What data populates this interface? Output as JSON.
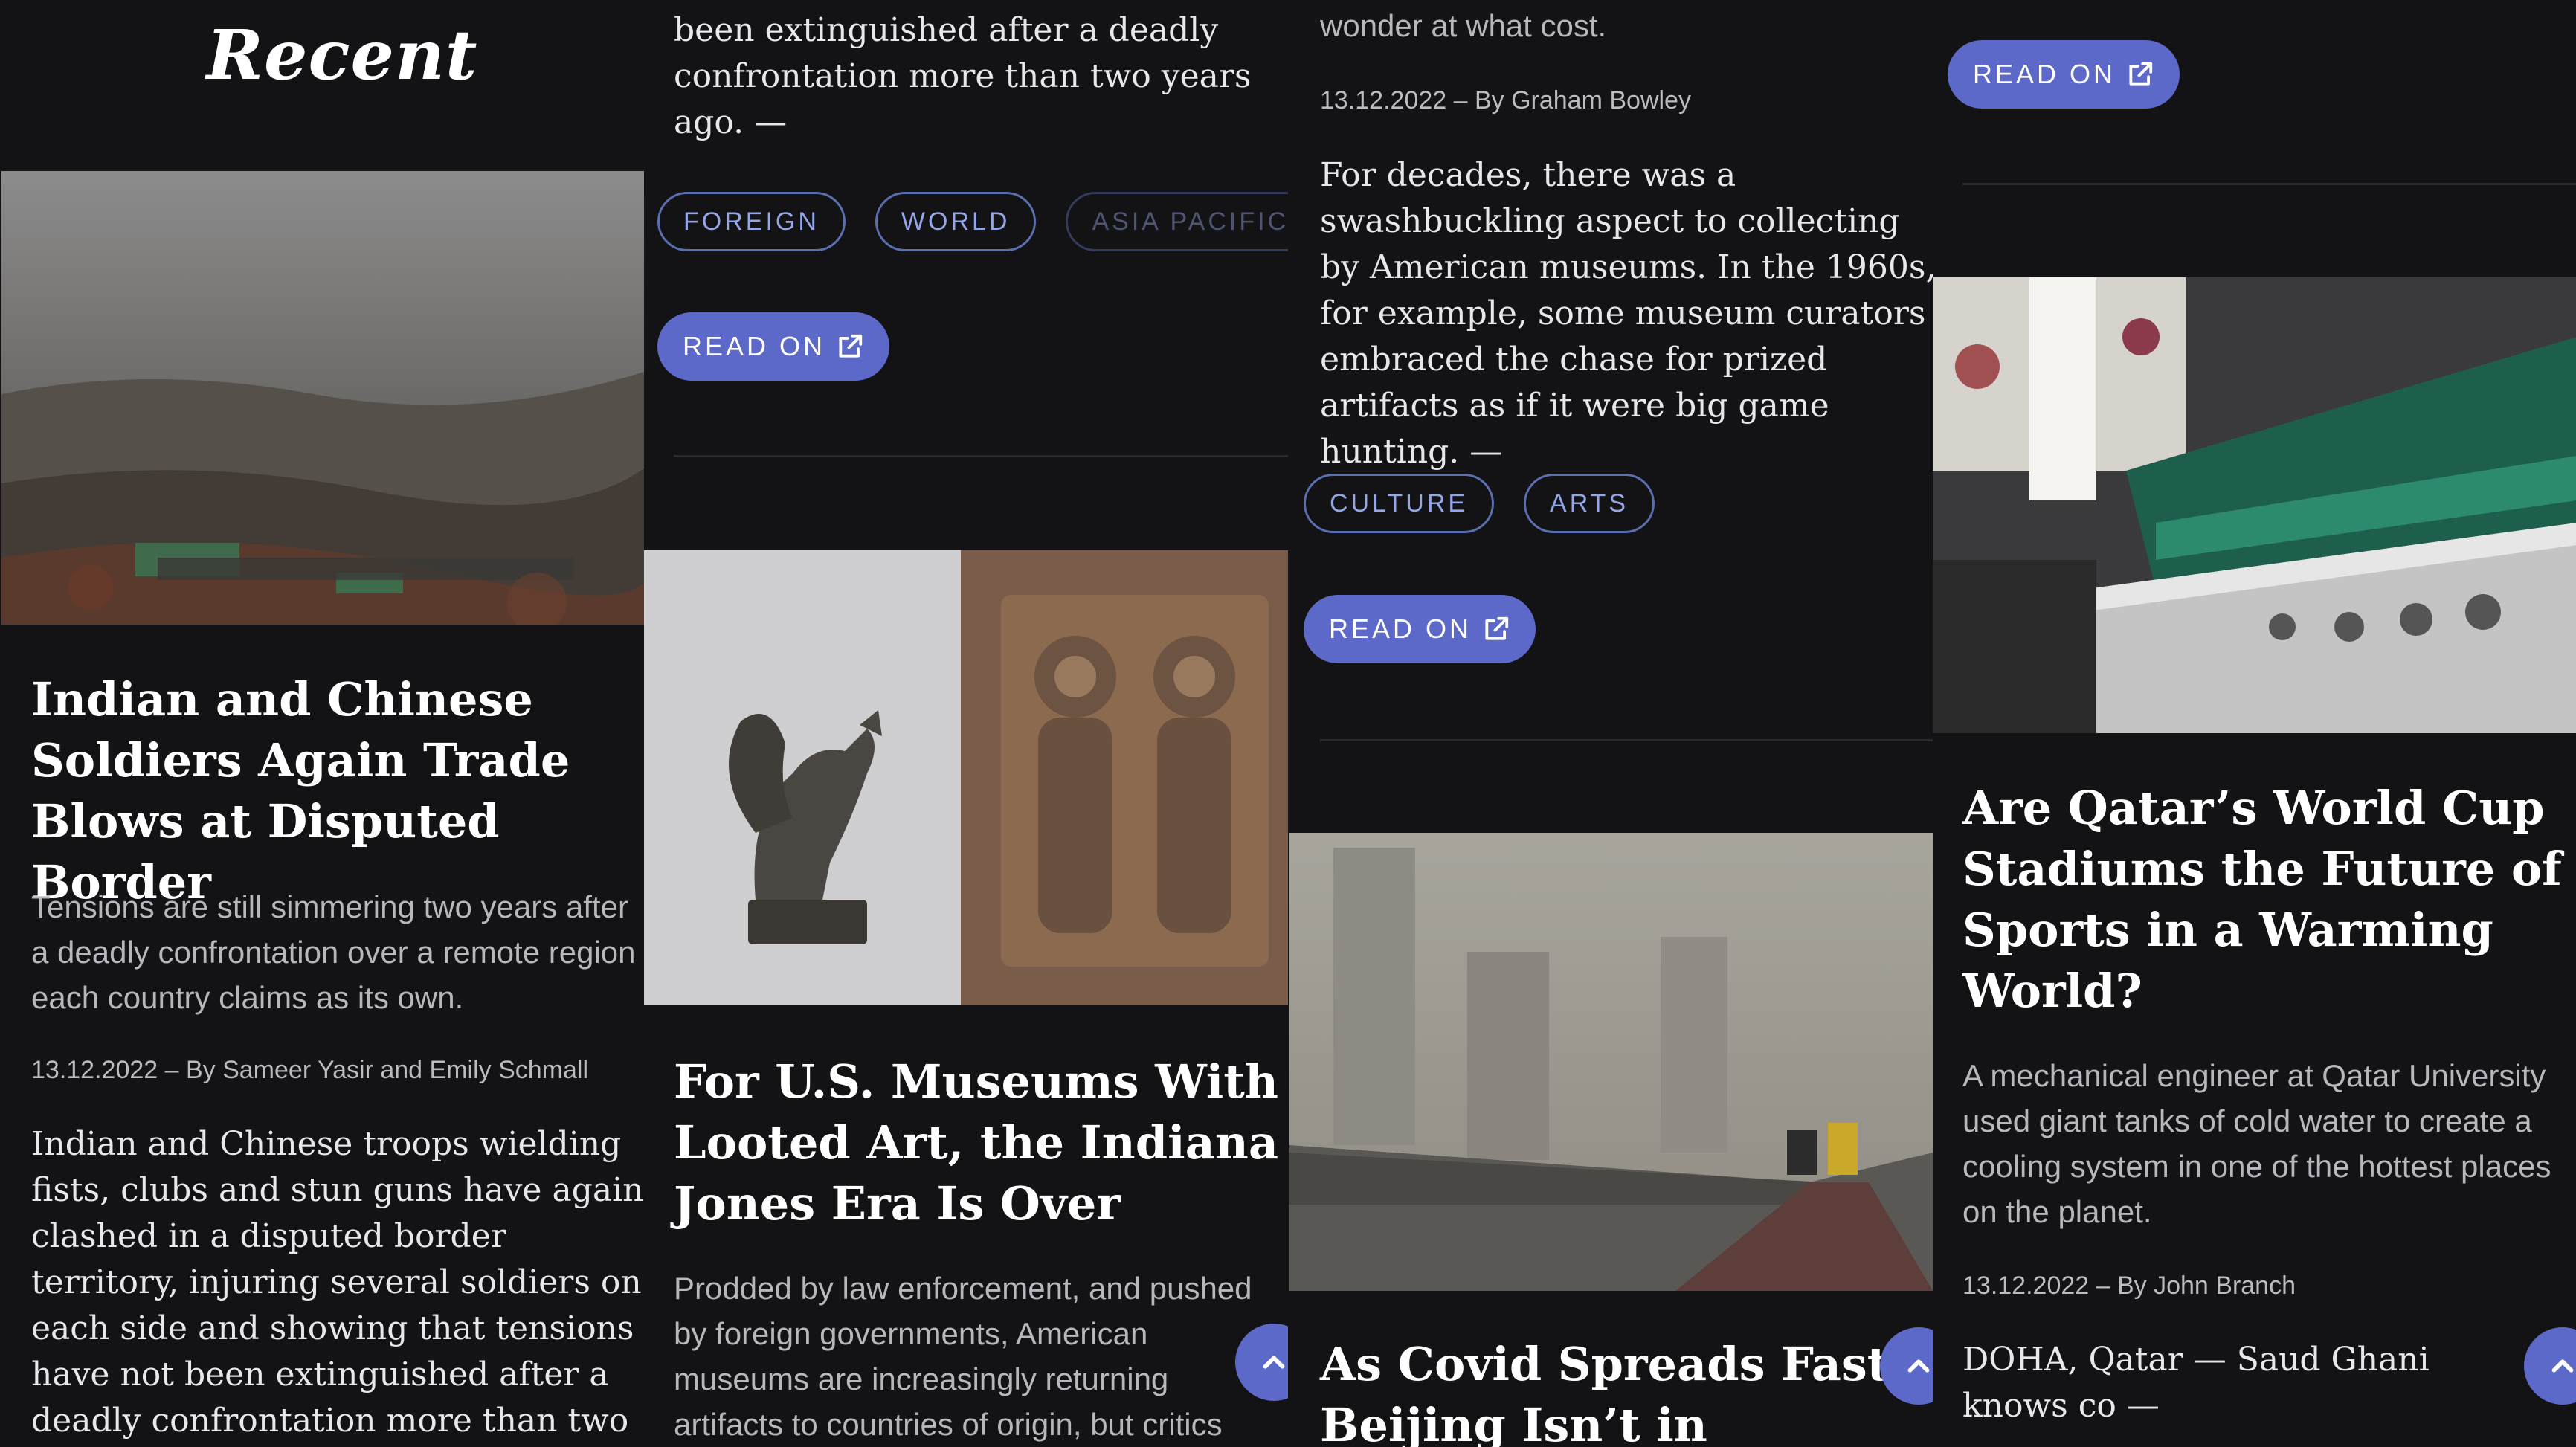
{
  "section_title": "Recent",
  "read_label": "READ ON",
  "icons": {
    "read": "external-link-icon",
    "fab": "chevron-up-icon"
  },
  "colors": {
    "background": "#131214",
    "accent": "#5d69c9",
    "tag_text": "#95a6e6"
  },
  "col1": {
    "title": "Indian and Chinese Soldiers Again Trade Blows at Disputed Border",
    "summary": "Tensions are still simmering two years after a deadly confrontation over a remote region each country claims as its own.",
    "meta": "13.12.2022 – By Sameer Yasir and Emily Schmall",
    "lead": "Indian and Chinese troops wielding fists, clubs and stun guns have again clashed in a disputed border territory, injuring several soldiers on each side and showing that tensions have not been extinguished after a deadly confrontation more than two years ago."
  },
  "col2": {
    "lead_tail": "been extinguished after a deadly confrontation more than two years ago. —",
    "tags": [
      "FOREIGN",
      "WORLD",
      "ASIA PACIFIC"
    ],
    "title": "For U.S. Museums With Looted Art, the Indiana Jones Era Is Over",
    "summary": "Prodded by law enforcement, and pushed by foreign governments, American museums are increasingly returning artifacts to countries of origin, but critics"
  },
  "col3": {
    "summary_tail": "wonder at what cost.",
    "meta": "13.12.2022 – By Graham Bowley",
    "lead": "For decades, there was a swashbuckling aspect to collecting by American museums. In the 1960s, for example, some museum curators embraced the chase for prized artifacts as if it were big game hunting. —",
    "tags": [
      "CULTURE",
      "ARTS"
    ],
    "title": "As Covid Spreads Fast, Beijing Isn’t in Lockdown."
  },
  "col4": {
    "title": "Are Qatar’s World Cup Stadiums the Future of Sports in a Warming World?",
    "summary": "A mechanical engineer at Qatar University used giant tanks of cold water to create a cooling system in one of the hottest places on the planet.",
    "meta": "13.12.2022 – By John Branch",
    "lead": "DOHA, Qatar — Saud Ghani knows co —"
  }
}
